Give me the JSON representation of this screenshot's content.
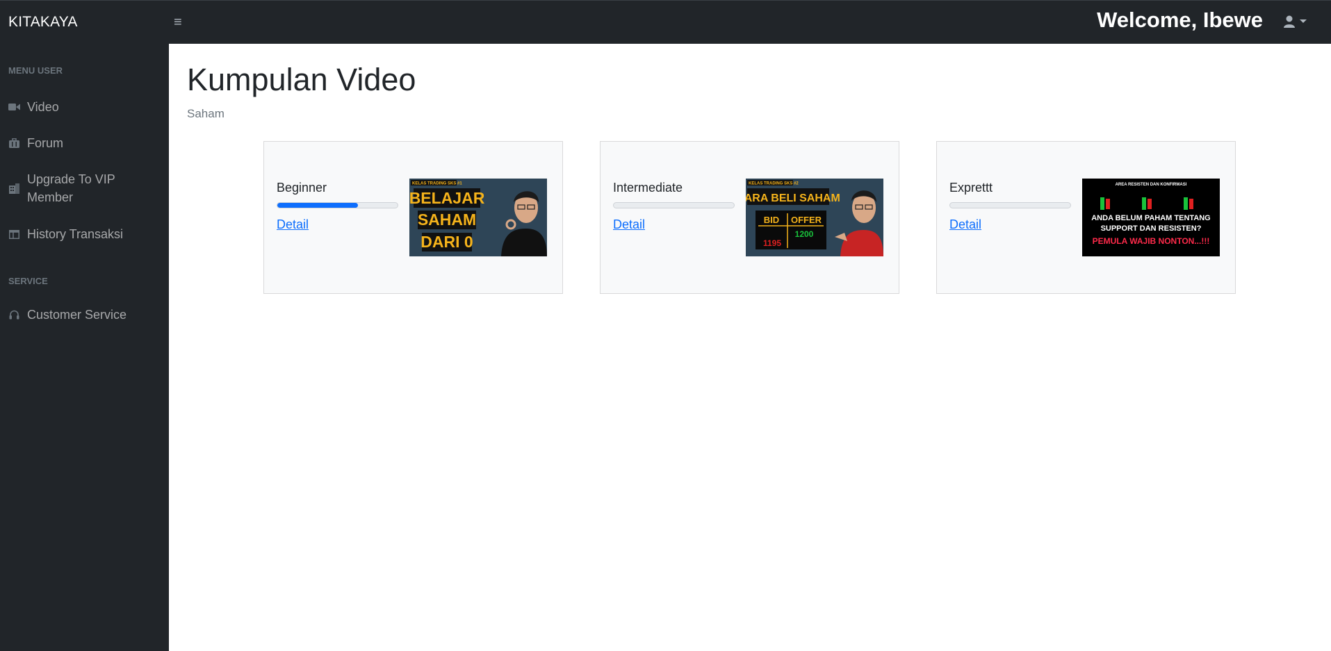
{
  "app": {
    "brand": "KITAKAYA",
    "welcome": "Welcome, Ibewe"
  },
  "sidebar": {
    "sections": [
      {
        "heading": "MENU USER",
        "items": [
          {
            "label": "Video",
            "icon": "video-camera-icon"
          },
          {
            "label": "Forum",
            "icon": "briefcase-icon"
          },
          {
            "label": "Upgrade To VIP Member",
            "icon": "building-icon"
          },
          {
            "label": "History Transaksi",
            "icon": "table-icon"
          }
        ]
      },
      {
        "heading": "SERVICE",
        "items": [
          {
            "label": "Customer Service",
            "icon": "headset-icon"
          }
        ]
      }
    ]
  },
  "main": {
    "title": "Kumpulan Video",
    "breadcrumb": "Saham",
    "cards": [
      {
        "title": "Beginner",
        "progress": 0.67,
        "link": "Detail",
        "thumb": {
          "tag": "KELAS TRADING SKS #1",
          "lines": [
            "BELAJAR",
            "SAHAM",
            "DARI 0"
          ]
        }
      },
      {
        "title": "Intermediate",
        "progress": 0,
        "link": "Detail",
        "thumb": {
          "tag": "KELAS TRADING SKS #2",
          "heading": "CARA BELI SAHAM",
          "bid": "BID",
          "offer": "OFFER",
          "bid_value": "1195",
          "offer_value": "1200"
        }
      },
      {
        "title": "Exprettt",
        "progress": 0,
        "link": "Detail",
        "thumb": {
          "tag": "AREA RESISTEN DAN KONFIRMASI",
          "line1": "ANDA BELUM PAHAM TENTANG",
          "line2": "SUPPORT DAN RESISTEN?",
          "line3": "PEMULA WAJIB NONTON...!!!"
        }
      }
    ]
  },
  "colors": {
    "dark": "#212529",
    "accent": "#0d6efd",
    "thumb_yellow": "#f5b31b",
    "thumb_bg": "#2e4557"
  }
}
